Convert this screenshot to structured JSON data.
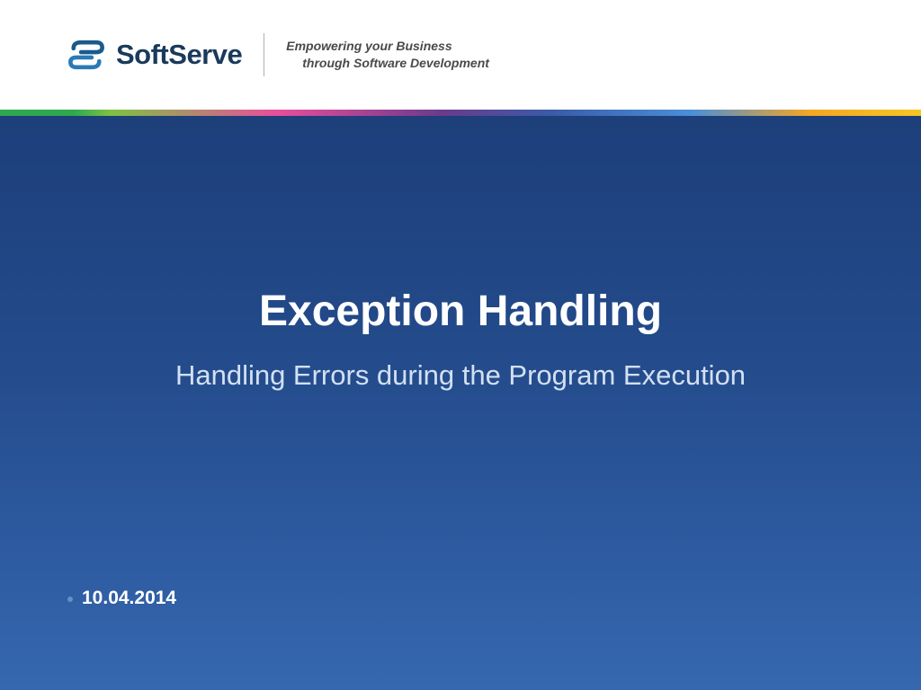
{
  "header": {
    "company_name_bold": "Soft",
    "company_name_rest": "Serve",
    "tagline_line1": "Empowering your Business",
    "tagline_line2": "through Software Development"
  },
  "main": {
    "title": "Exception Handling",
    "subtitle": "Handling Errors during the Program Execution",
    "date": "10.04.2014"
  }
}
